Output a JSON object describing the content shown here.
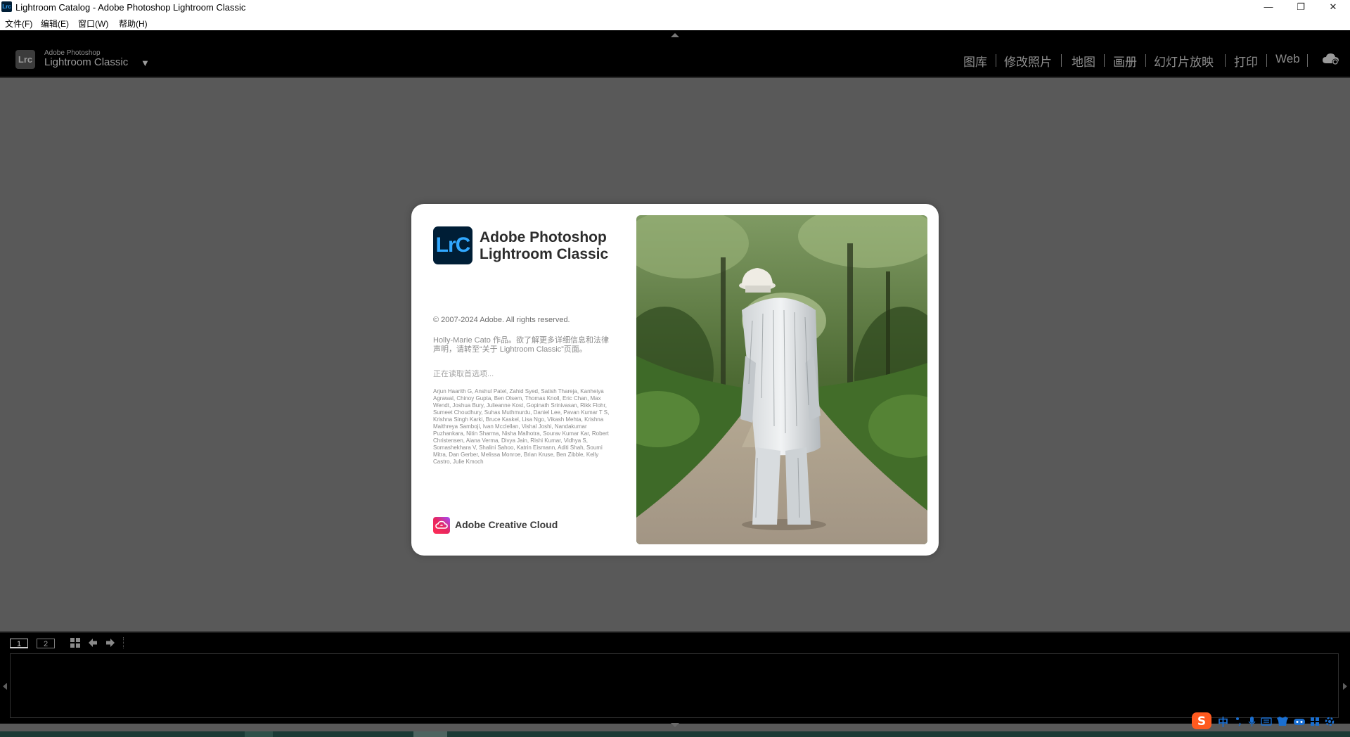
{
  "window": {
    "app_icon_text": "Lrc",
    "title": "Lightroom Catalog - Adobe Photoshop Lightroom Classic",
    "minimize_glyph": "—",
    "restore_glyph": "❐",
    "close_glyph": "✕"
  },
  "menubar": {
    "items": [
      {
        "label": "文件(F)"
      },
      {
        "label": "编辑(E)"
      },
      {
        "label": "窗口(W)"
      },
      {
        "label": "帮助(H)"
      }
    ]
  },
  "identity_plate": {
    "badge": "Lrc",
    "company": "Adobe Photoshop",
    "product": "Lightroom Classic",
    "dropdown_glyph": "▼"
  },
  "modules": [
    {
      "label": "图库"
    },
    {
      "label": "修改照片"
    },
    {
      "label": "地图"
    },
    {
      "label": "画册"
    },
    {
      "label": "幻灯片放映"
    },
    {
      "label": "打印"
    },
    {
      "label": "Web"
    }
  ],
  "icons": {
    "cloud": "cloud-sync-icon",
    "grid": "grid-icon",
    "prev": "arrow-left-icon",
    "next": "arrow-right-icon",
    "cc": "creative-cloud-icon"
  },
  "splash": {
    "logo_text": "LrC",
    "product_line1": "Adobe Photoshop",
    "product_line2": "Lightroom Classic",
    "copyright": "© 2007-2024 Adobe. All rights reserved.",
    "credit": "Holly-Marie Cato 作品。欲了解更多详细信息和法律声明，请转至“关于 Lightroom Classic”页面。",
    "loading": "正在读取首选项...",
    "contributors": "Arjun Haarith G, Anshul Patel, Zahid Syed, Satish Thareja, Kanheiya Agrawal, Chinoy Gupta, Ben Olsem, Thomas Knoll, Eric Chan, Max Wendt, Joshua Bury, Julieanne Kost, Gopinath Srinivasan, Rikk Flohr, Sumeet Choudhury, Suhas Muthmurdu, Daniel Lee, Pavan Kumar T S, Krishna Singh Karki, Bruce Kaskel, Lisa Ngo, Vikash Mehta, Krishna Maithreya Samboji, Ivan Mcclellan, Vishal Joshi, Nandakumar Puzhankara, Nitin Sharma, Nisha Malhotra, Sourav Kumar Kar, Robert Christensen, Aiana Verma, Divya Jain, Rishi Kumar, Vidhya S, Somashekhara V, Shalini Sahoo, Katrin Eismann, Aditi Shah, Soumi Mitra, Dan Gerber, Melissa Monroe, Brian Kruse, Ben Zibble, Kelly Castro, Julie Kmoch",
    "cc_label": "Adobe Creative Cloud"
  },
  "filmstrip": {
    "view1": "1",
    "view2": "2"
  },
  "taskbar": {
    "ime_label": "中"
  },
  "colors": {
    "workspace": "#595959",
    "panel": "#000000",
    "module_text": "#8e8e8e",
    "lrc_tile": "#001e36",
    "lrc_text": "#31a8ff",
    "sogou": "#ff5a1f",
    "ime_blue": "#1a6fd1"
  }
}
